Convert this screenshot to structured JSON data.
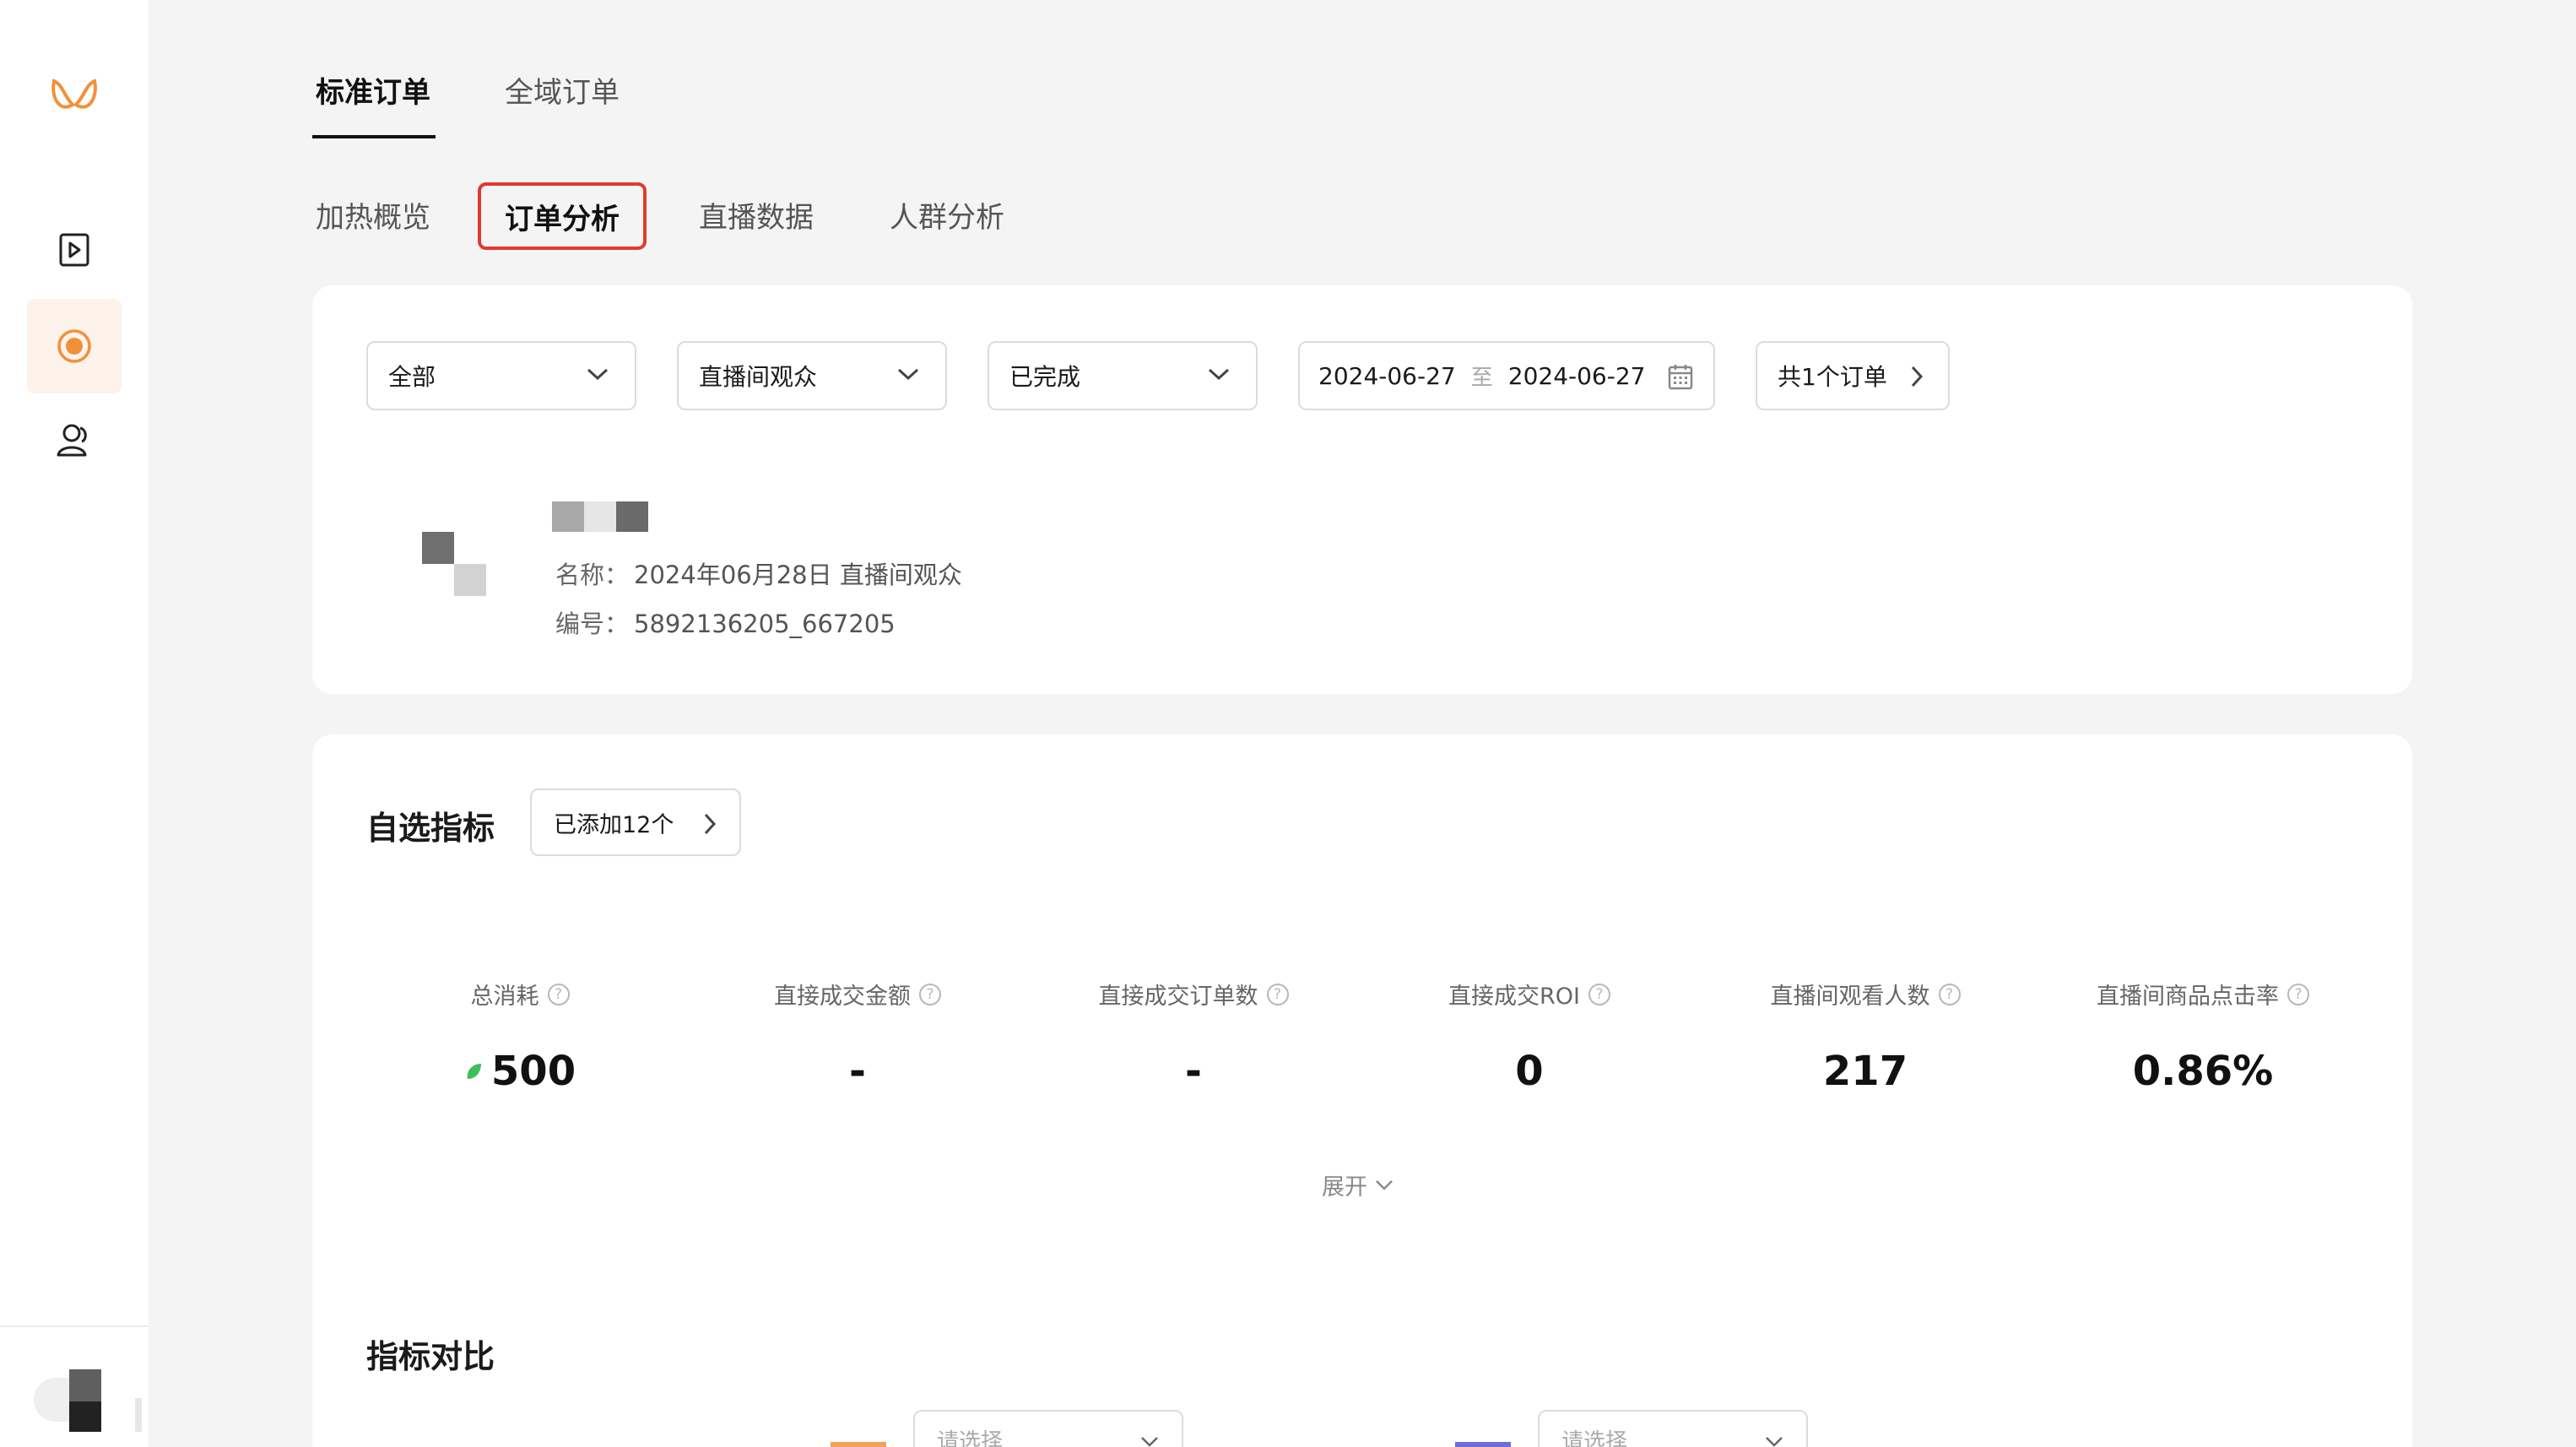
{
  "colors": {
    "accent": "#f0913a",
    "highlight_border": "#e23a2c",
    "compare_a": "#f2a25a",
    "compare_b": "#6b6fd6",
    "leaf": "#3fbf5a"
  },
  "top_tabs": [
    {
      "label": "标准订单",
      "active": true
    },
    {
      "label": "全域订单",
      "active": false
    }
  ],
  "sub_tabs": [
    {
      "label": "加热概览"
    },
    {
      "label": "订单分析",
      "active": true
    },
    {
      "label": "直播数据"
    },
    {
      "label": "人群分析"
    }
  ],
  "filters": {
    "scope": "全部",
    "audience": "直播间观众",
    "status": "已完成",
    "date_start": "2024-06-27",
    "date_sep": "至",
    "date_end": "2024-06-27",
    "order_count": "共1个订单"
  },
  "order": {
    "name_label": "名称：",
    "name_value": "2024年06月28日 直播间观众",
    "id_label": "编号：",
    "id_value": "5892136205_667205"
  },
  "metrics_section": {
    "title": "自选指标",
    "added_label": "已添加12个",
    "expand_label": "展开",
    "items": [
      {
        "label": "总消耗",
        "value": "500",
        "icon": "leaf-icon"
      },
      {
        "label": "直接成交金额",
        "value": "-"
      },
      {
        "label": "直接成交订单数",
        "value": "-"
      },
      {
        "label": "直接成交ROI",
        "value": "0"
      },
      {
        "label": "直播间观看人数",
        "value": "217"
      },
      {
        "label": "直播间商品点击率",
        "value": "0.86%"
      }
    ]
  },
  "compare_section": {
    "title": "指标对比",
    "select_a_placeholder": "请选择",
    "select_b_placeholder": "请选择"
  }
}
